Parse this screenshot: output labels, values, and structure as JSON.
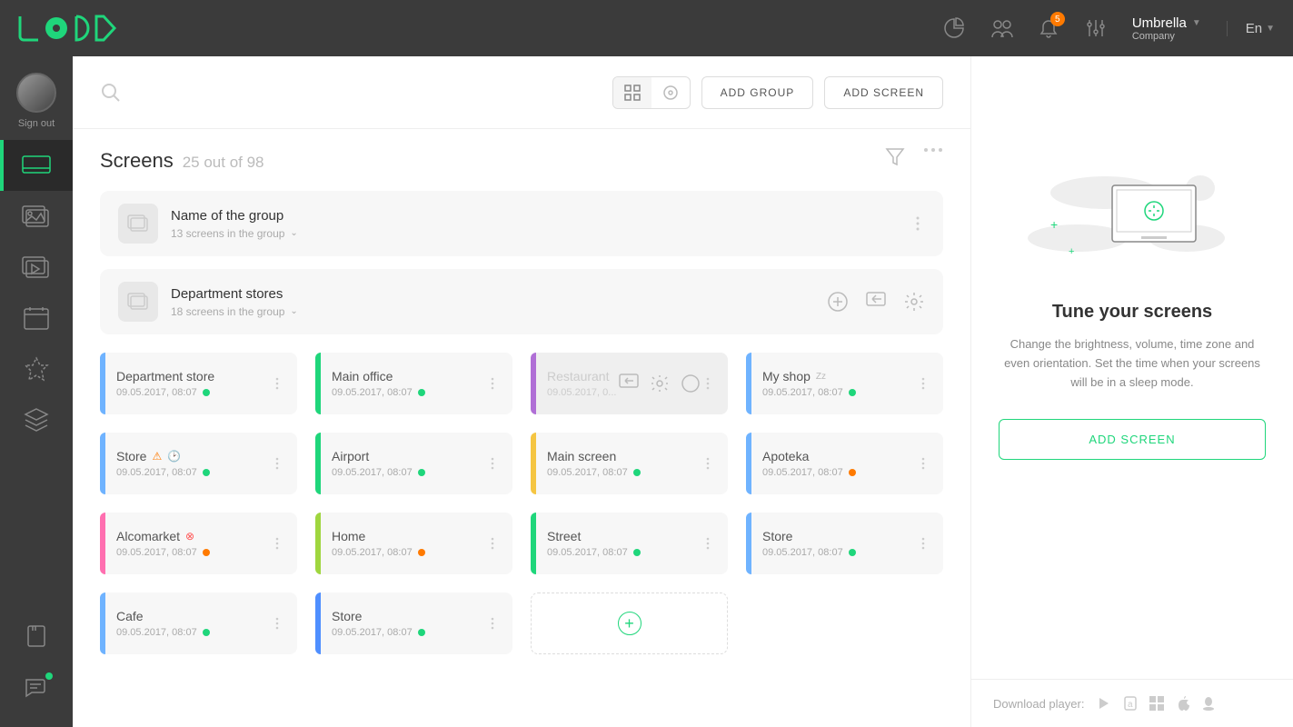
{
  "header": {
    "notifications_count": "5",
    "company_name": "Umbrella",
    "company_sub": "Company",
    "lang": "En"
  },
  "sidebar": {
    "sign_out": "Sign out"
  },
  "toolbar": {
    "add_group": "ADD GROUP",
    "add_screen": "ADD SCREEN"
  },
  "page": {
    "title": "Screens",
    "count": "25 out of 98"
  },
  "groups": [
    {
      "name": "Name of the group",
      "count": "13 screens in the group"
    },
    {
      "name": "Department stores",
      "count": "18 screens in the group"
    }
  ],
  "screens": [
    {
      "name": "Department store",
      "date": "09.05.2017, 08:07",
      "color": "#6fb3ff",
      "status": "#1fd67b"
    },
    {
      "name": "Main office",
      "date": "09.05.2017, 08:07",
      "color": "#1fd67b",
      "status": "#1fd67b"
    },
    {
      "name": "Restaurant",
      "date": "09.05.2017, 0...",
      "color": "#b06fd6",
      "status": "",
      "hover": true
    },
    {
      "name": "My shop",
      "date": "09.05.2017, 08:07",
      "color": "#6fb3ff",
      "status": "#1fd67b",
      "sleep": "Zz"
    },
    {
      "name": "Store",
      "date": "09.05.2017, 08:07",
      "color": "#6fb3ff",
      "status": "#1fd67b",
      "warn": true
    },
    {
      "name": "Airport",
      "date": "09.05.2017, 08:07",
      "color": "#1fd67b",
      "status": "#1fd67b"
    },
    {
      "name": "Main screen",
      "date": "09.05.2017, 08:07",
      "color": "#f5c542",
      "status": "#1fd67b"
    },
    {
      "name": "Apoteka",
      "date": "09.05.2017, 08:07",
      "color": "#6fb3ff",
      "status": "#ff7a00"
    },
    {
      "name": "Alcomarket",
      "date": "09.05.2017, 08:07",
      "color": "#ff6fb0",
      "status": "#ff7a00",
      "err": true
    },
    {
      "name": "Home",
      "date": "09.05.2017, 08:07",
      "color": "#9fd63f",
      "status": "#ff7a00"
    },
    {
      "name": "Street",
      "date": "09.05.2017, 08:07",
      "color": "#1fd67b",
      "status": "#1fd67b"
    },
    {
      "name": "Store",
      "date": "09.05.2017, 08:07",
      "color": "#6fb3ff",
      "status": "#1fd67b"
    },
    {
      "name": "Cafe",
      "date": "09.05.2017, 08:07",
      "color": "#6fb3ff",
      "status": "#1fd67b"
    },
    {
      "name": "Store",
      "date": "09.05.2017, 08:07",
      "color": "#4f8fff",
      "status": "#1fd67b"
    }
  ],
  "panel": {
    "title": "Tune your screens",
    "text": "Change the brightness, volume, time zone and even orientation. Set the time when your screens will be in a sleep mode.",
    "btn": "ADD SCREEN",
    "download_label": "Download player:"
  }
}
